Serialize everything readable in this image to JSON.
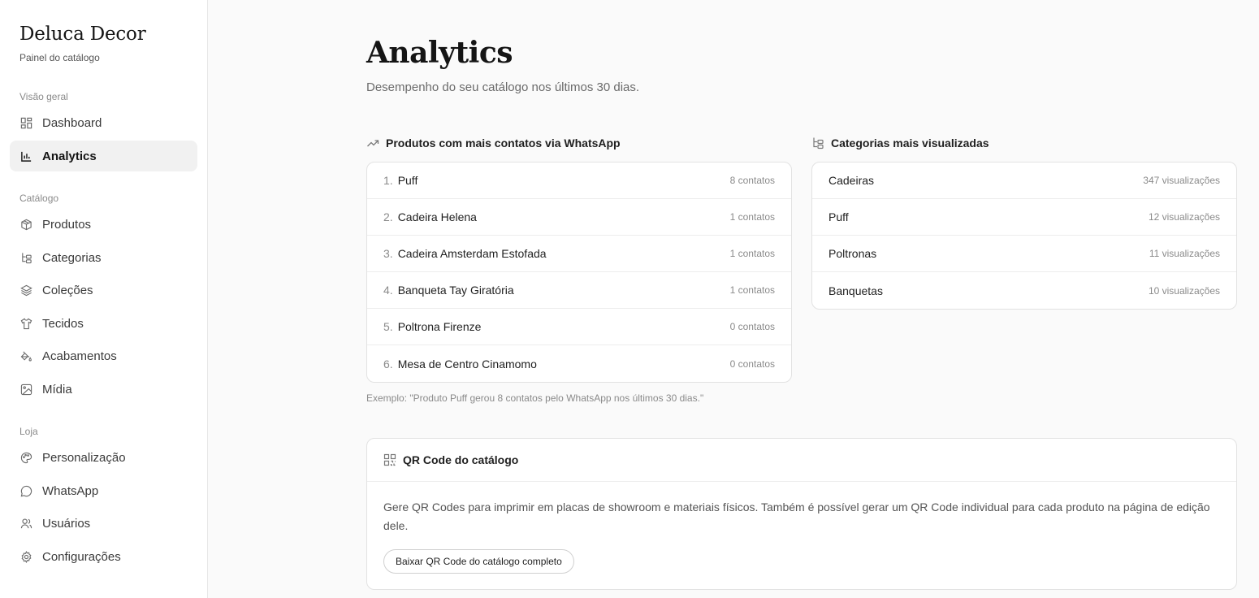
{
  "brand": {
    "name": "Deluca Decor",
    "subtitle": "Painel do catálogo"
  },
  "sidebar": {
    "sections": [
      {
        "label": "Visão geral",
        "items": [
          {
            "label": "Dashboard",
            "icon": "dashboard-icon"
          },
          {
            "label": "Analytics",
            "icon": "bar-chart-icon",
            "active": true
          }
        ]
      },
      {
        "label": "Catálogo",
        "items": [
          {
            "label": "Produtos",
            "icon": "package-icon"
          },
          {
            "label": "Categorias",
            "icon": "tree-icon"
          },
          {
            "label": "Coleções",
            "icon": "layers-icon"
          },
          {
            "label": "Tecidos",
            "icon": "shirt-icon"
          },
          {
            "label": "Acabamentos",
            "icon": "paint-bucket-icon"
          },
          {
            "label": "Mídia",
            "icon": "image-icon"
          }
        ]
      },
      {
        "label": "Loja",
        "items": [
          {
            "label": "Personalização",
            "icon": "palette-icon"
          },
          {
            "label": "WhatsApp",
            "icon": "chat-icon"
          },
          {
            "label": "Usuários",
            "icon": "users-icon"
          },
          {
            "label": "Configurações",
            "icon": "gear-icon"
          }
        ]
      }
    ]
  },
  "main": {
    "title": "Analytics",
    "subtitle": "Desempenho do seu catálogo nos últimos 30 dias.",
    "top_products": {
      "title": "Produtos com mais contatos via WhatsApp",
      "icon": "trending-up-icon",
      "rows": [
        {
          "rank": "1.",
          "name": "Puff",
          "value": "8 contatos"
        },
        {
          "rank": "2.",
          "name": "Cadeira Helena",
          "value": "1 contatos"
        },
        {
          "rank": "3.",
          "name": "Cadeira Amsterdam Estofada",
          "value": "1 contatos"
        },
        {
          "rank": "4.",
          "name": "Banqueta Tay Giratória",
          "value": "1 contatos"
        },
        {
          "rank": "5.",
          "name": "Poltrona Firenze",
          "value": "0 contatos"
        },
        {
          "rank": "6.",
          "name": "Mesa de Centro Cinamomo",
          "value": "0 contatos"
        }
      ],
      "example": "Exemplo: \"Produto Puff gerou 8 contatos pelo WhatsApp nos últimos 30 dias.\""
    },
    "top_categories": {
      "title": "Categorias mais visualizadas",
      "icon": "tree-icon",
      "rows": [
        {
          "name": "Cadeiras",
          "value": "347 visualizações"
        },
        {
          "name": "Puff",
          "value": "12 visualizações"
        },
        {
          "name": "Poltronas",
          "value": "11 visualizações"
        },
        {
          "name": "Banquetas",
          "value": "10 visualizações"
        }
      ]
    },
    "qr": {
      "title": "QR Code do catálogo",
      "icon": "qr-code-icon",
      "description": "Gere QR Codes para imprimir em placas de showroom e materiais físicos. Também é possível gerar um QR Code individual para cada produto na página de edição dele.",
      "button": "Baixar QR Code do catálogo completo"
    }
  }
}
